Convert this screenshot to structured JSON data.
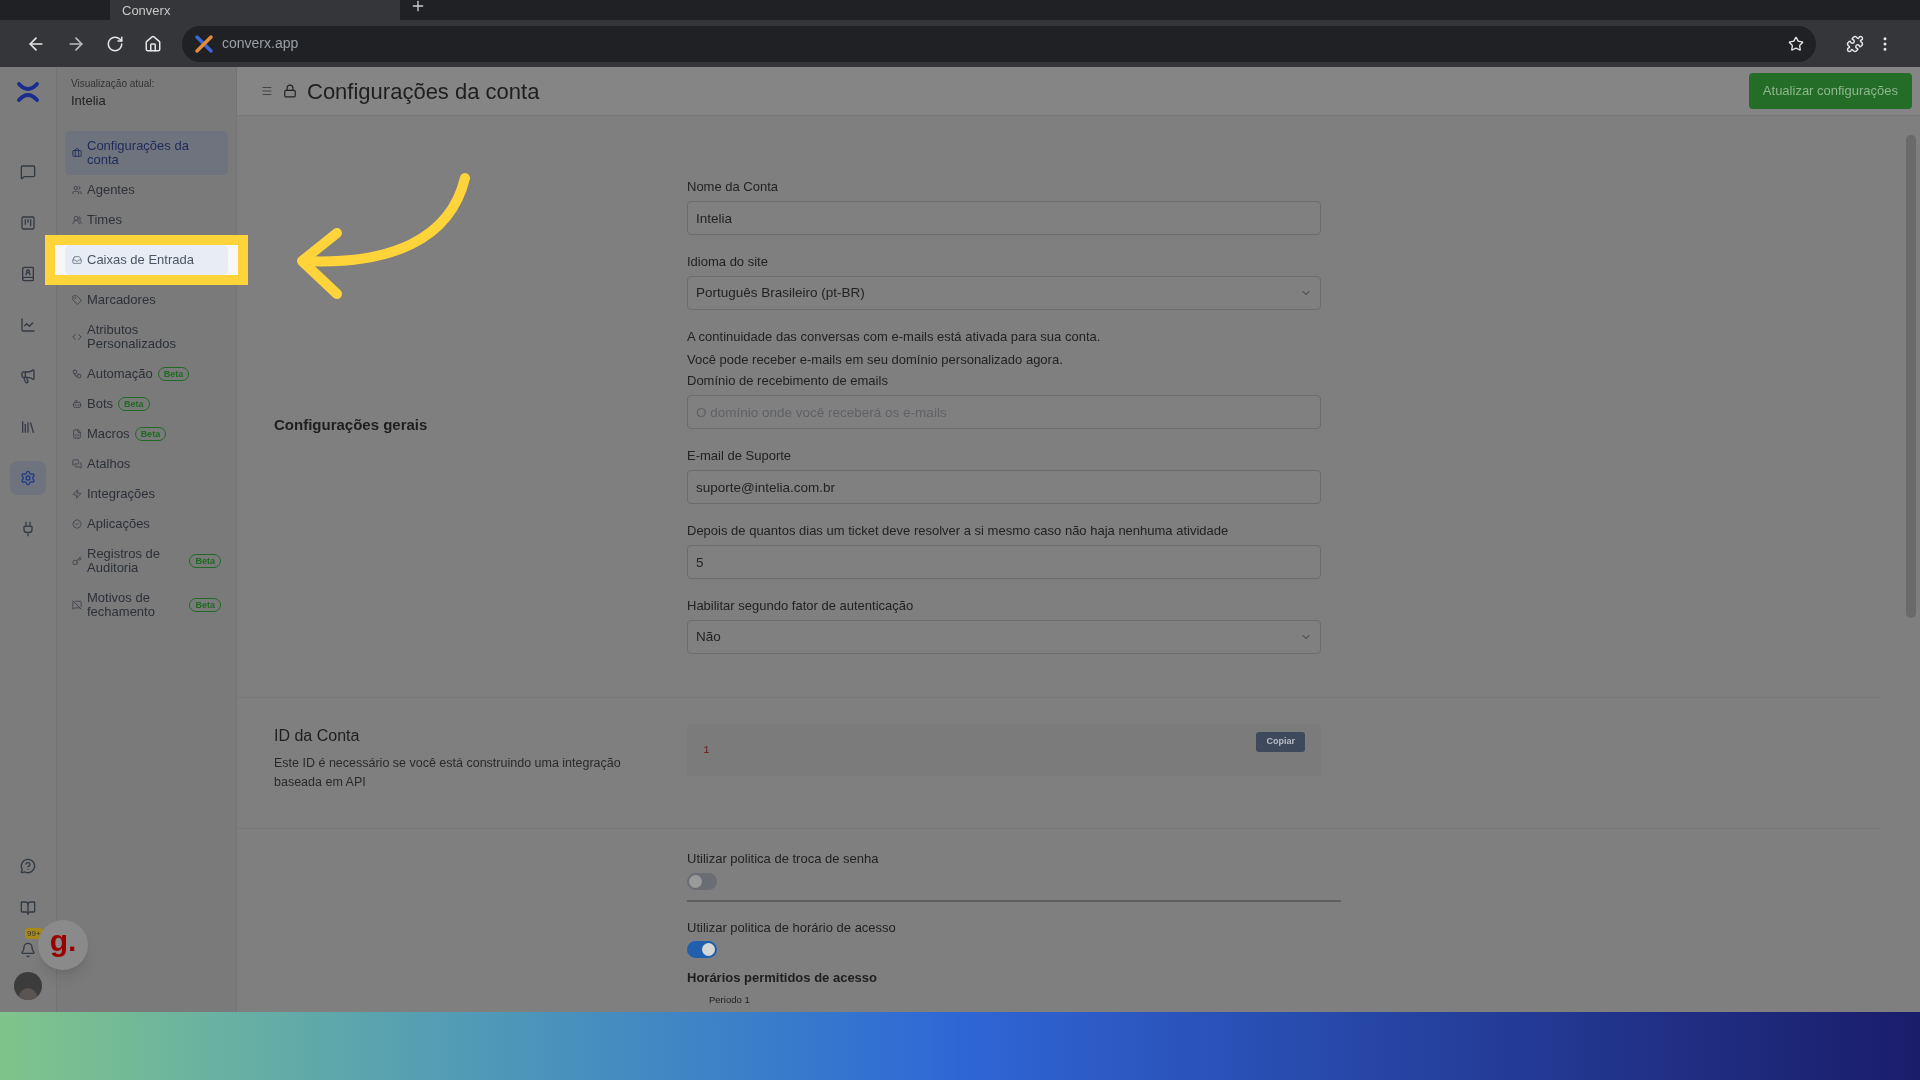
{
  "browser": {
    "tab_title": "Converx",
    "url": "converx.app"
  },
  "account_view": {
    "label": "Visualização atual:",
    "value": "Intelia"
  },
  "nav_rail": {
    "items": [
      {
        "selected": false
      },
      {
        "selected": false
      },
      {
        "selected": false
      },
      {
        "selected": false
      },
      {
        "selected": false
      },
      {
        "selected": false
      },
      {
        "selected": true
      },
      {
        "selected": false
      }
    ],
    "bottom_items": [
      {
        "kind": "help"
      },
      {
        "kind": "docs"
      },
      {
        "kind": "notifications",
        "badge": "99+"
      }
    ]
  },
  "settings_menu": [
    {
      "label": "Configurações da conta",
      "selected": true,
      "spotlight": false
    },
    {
      "label": "Agentes",
      "selected": false,
      "spotlight": false
    },
    {
      "label": "Times",
      "selected": false,
      "spotlight": false
    },
    {
      "label": "Caixas de Entrada",
      "selected": false,
      "spotlight": true
    },
    {
      "label": "Marcadores",
      "selected": false,
      "spotlight": false
    },
    {
      "label": "Atributos Personalizados",
      "selected": false,
      "spotlight": false
    },
    {
      "label": "Automação",
      "selected": false,
      "spotlight": false,
      "badge": "Beta"
    },
    {
      "label": "Bots",
      "selected": false,
      "spotlight": false,
      "badge": "Beta"
    },
    {
      "label": "Macros",
      "selected": false,
      "spotlight": false,
      "badge": "Beta"
    },
    {
      "label": "Atalhos",
      "selected": false,
      "spotlight": false
    },
    {
      "label": "Integrações",
      "selected": false,
      "spotlight": false
    },
    {
      "label": "Aplicações",
      "selected": false,
      "spotlight": false
    },
    {
      "label": "Registros de Auditoria",
      "selected": false,
      "spotlight": false,
      "badge": "Beta"
    },
    {
      "label": "Motivos de fechamento",
      "selected": false,
      "spotlight": false,
      "badge": "Beta"
    }
  ],
  "page_title": "Configurações da conta",
  "update_button": "Atualizar configurações",
  "general_section": {
    "title": "Configurações gerais",
    "fields": [
      {
        "kind": "text",
        "label": "Nome da Conta",
        "value": "Intelia"
      },
      {
        "kind": "select",
        "label": "Idioma do site",
        "value": "Português Brasileiro (pt-BR)"
      },
      {
        "kind": "note",
        "lines": [
          "A continuidade das conversas com e-mails está ativada para sua conta.",
          "Você pode receber e-mails em seu domínio personalizado agora."
        ]
      },
      {
        "kind": "text",
        "label": "Domínio de recebimento de emails",
        "placeholder": "O domínio onde você receberá os e-mails"
      },
      {
        "kind": "text",
        "label": "E-mail de Suporte",
        "value": "suporte@intelia.com.br"
      },
      {
        "kind": "text",
        "label": "Depois de quantos dias um ticket deve resolver a si mesmo caso não haja nenhuma atividade",
        "value": "5"
      },
      {
        "kind": "select",
        "label": "Habilitar segundo fator de autenticação",
        "value": "Não"
      }
    ]
  },
  "account_id": {
    "title": "ID da Conta",
    "description": "Este ID é necessário se você está construindo uma integração baseada em API",
    "value": "1",
    "copy_button": "Copiar"
  },
  "policies": [
    {
      "label": "Utilizar politica de troca de senha",
      "on": false
    },
    {
      "label": "Utilizar politica de horário de acesso",
      "on": true
    }
  ],
  "access_hours": {
    "title": "Horários permitidos de acesso",
    "periods": [
      "Periodo 1"
    ]
  },
  "helper_button": "g."
}
